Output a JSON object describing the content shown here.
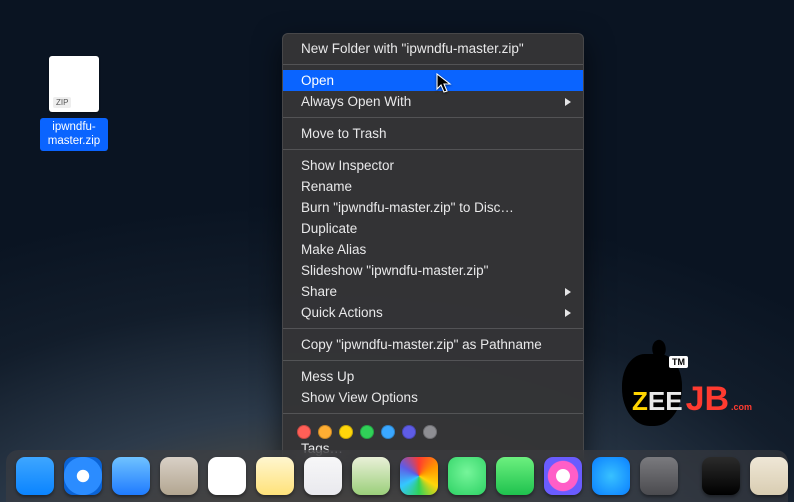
{
  "file": {
    "name": "ipwndfu-master.zip"
  },
  "context_menu": {
    "new_folder": "New Folder with \"ipwndfu-master.zip\"",
    "open": "Open",
    "always_open_with": "Always Open With",
    "move_to_trash": "Move to Trash",
    "show_inspector": "Show Inspector",
    "rename": "Rename",
    "burn": "Burn \"ipwndfu-master.zip\" to Disc…",
    "duplicate": "Duplicate",
    "make_alias": "Make Alias",
    "slideshow": "Slideshow \"ipwndfu-master.zip\"",
    "share": "Share",
    "quick_actions": "Quick Actions",
    "copy_pathname": "Copy \"ipwndfu-master.zip\" as Pathname",
    "mess_up": "Mess Up",
    "show_view_options": "Show View Options",
    "tags_label": "Tags…"
  },
  "tag_colors": [
    "#ff5f57",
    "#ffae33",
    "#ffd60a",
    "#30d158",
    "#3aa7ff",
    "#5e5ce6",
    "#8e8e93"
  ],
  "dock": {
    "apps": [
      {
        "name": "finder-app",
        "color": "linear-gradient(#3ea6ff,#0a84ff)"
      },
      {
        "name": "safari-app",
        "color": "radial-gradient(circle at 50% 50%,#fff 22%,#2b8cff 24% 70%,#0a63d6 72%)"
      },
      {
        "name": "mail-app",
        "color": "linear-gradient(#6fc2ff,#1f7bff)"
      },
      {
        "name": "contacts-app",
        "color": "linear-gradient(#d9d0c6,#b3a691)"
      },
      {
        "name": "calendar-app",
        "color": "linear-gradient(#fff,#fff)"
      },
      {
        "name": "notes-app",
        "color": "linear-gradient(#fff6cf,#ffe27a)"
      },
      {
        "name": "reminders-app",
        "color": "linear-gradient(#f7f7f8,#e9e9ee)"
      },
      {
        "name": "maps-app",
        "color": "linear-gradient(#e9f0d8,#9bcf7a)"
      },
      {
        "name": "photos-app",
        "color": "conic-gradient(#ff3b30,#ff9500,#ffd60a,#30d158,#34c7ff,#5e5ce6,#ff3b30)"
      },
      {
        "name": "messages-app",
        "color": "radial-gradient(circle at 50% 40%,#76f59a,#2dd264)"
      },
      {
        "name": "facetime-app",
        "color": "linear-gradient(#6cf07f,#1fc24e)"
      },
      {
        "name": "itunes-app",
        "color": "radial-gradient(circle at 50% 50%,#fff 25%,#ff5ec7 27% 55%,#6a5cff 58%)"
      },
      {
        "name": "appstore-app",
        "color": "radial-gradient(circle at 50% 50%,#38c1ff,#0a7fff)"
      },
      {
        "name": "preferences-app",
        "color": "linear-gradient(#7a7a7e,#4b4b4f)"
      }
    ],
    "right": [
      {
        "name": "terminal-app",
        "color": "linear-gradient(#2b2b2b,#000)"
      },
      {
        "name": "font-app",
        "color": "linear-gradient(#efe7d6,#d9cdb2)"
      },
      {
        "name": "trash-app",
        "color": "linear-gradient(#9aa0a7,#6c7177)"
      }
    ]
  },
  "watermark": {
    "z": "Z",
    "ee": "EE",
    "jb": "JB",
    "com": ".com",
    "tm": "TM"
  }
}
